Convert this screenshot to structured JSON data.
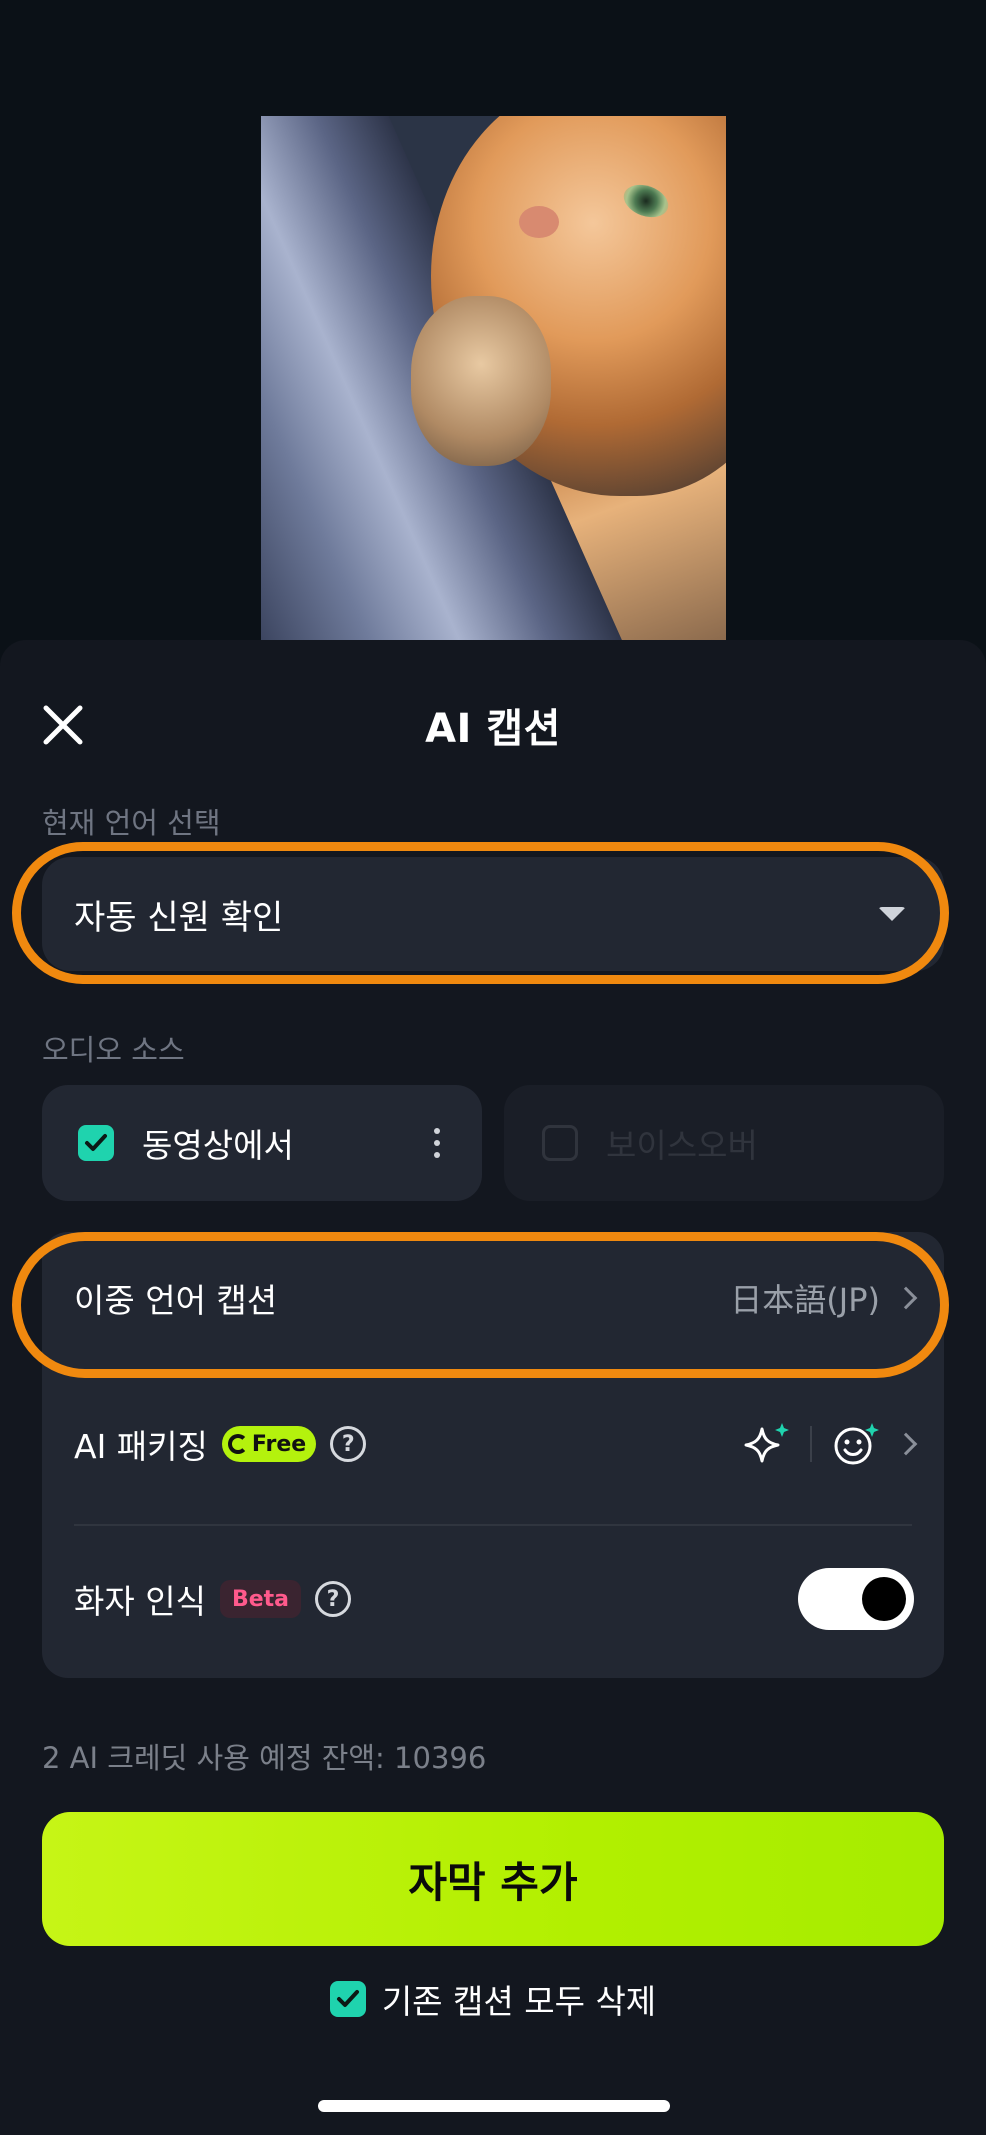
{
  "header": {
    "title": "AI 캡션"
  },
  "language": {
    "section_label": "현재 언어 선택",
    "selected": "자동 신원 확인"
  },
  "audio_source": {
    "section_label": "오디오 소스",
    "video": {
      "label": "동영상에서",
      "checked": true
    },
    "voiceover": {
      "label": "보이스오버",
      "checked": false,
      "disabled": true
    }
  },
  "options": {
    "bilingual": {
      "label": "이중 언어 캡션",
      "value": "日本語(JP)"
    },
    "packaging": {
      "label": "AI 패키징",
      "badge": "Free",
      "help": "?"
    },
    "speaker": {
      "label": "화자 인식",
      "badge": "Beta",
      "help": "?",
      "enabled": true
    }
  },
  "credits": {
    "text": "2 AI 크레딧 사용 예정 잔액: 10396"
  },
  "primary_button": {
    "label": "자막 추가"
  },
  "delete_existing": {
    "label": "기존 캡션 모두 삭제",
    "checked": true
  },
  "colors": {
    "accent": "#b4f20d",
    "check": "#1fd3ae",
    "highlight": "#f0890f",
    "beta": "#ff5a8c"
  },
  "icons": [
    "close-icon",
    "caret-down-icon",
    "check-icon",
    "more-vertical-icon",
    "chevron-right-icon",
    "sparkle-icon",
    "smile-sparkle-icon",
    "help-icon"
  ]
}
